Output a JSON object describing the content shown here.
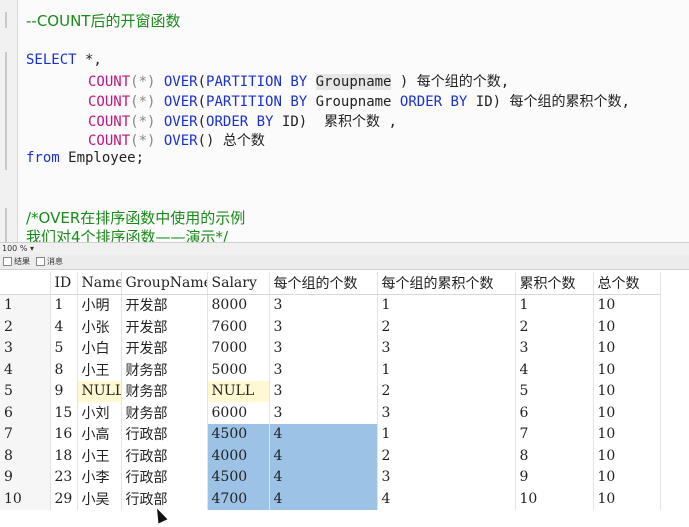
{
  "editor": {
    "comment_top": "--COUNT后的开窗函数",
    "select_kw": "SELECT",
    "select_rest": " *,",
    "lines": [
      {
        "fn": "COUNT",
        "args": "(*) ",
        "over": "OVER",
        "body_a": "(",
        "k1": "PARTITION BY",
        "body_b": " ",
        "hl": "Groupname",
        "body_c": " ) ",
        "k2": "",
        "body_d": "",
        "comment": "每个组的个数",
        "tail": ","
      },
      {
        "fn": "COUNT",
        "args": "(*) ",
        "over": "OVER",
        "body_a": "(",
        "k1": "PARTITION BY",
        "body_b": " Groupname ",
        "hl": "",
        "body_c": "",
        "k2": "ORDER BY",
        "body_d": " ID) ",
        "comment": "每个组的累积个数",
        "tail": ","
      },
      {
        "fn": "COUNT",
        "args": "(*) ",
        "over": "OVER",
        "body_a": "(",
        "k1": "ORDER BY",
        "body_b": " ID)  ",
        "hl": "",
        "body_c": "",
        "k2": "",
        "body_d": "",
        "comment": "累积个数",
        "tail": " ,"
      },
      {
        "fn": "COUNT",
        "args": "(*) ",
        "over": "OVER",
        "body_a": "() ",
        "k1": "",
        "body_b": "",
        "hl": "",
        "body_c": "",
        "k2": "",
        "body_d": "",
        "comment": "总个数",
        "tail": ""
      }
    ],
    "from_kw": "from",
    "from_rest": " Employee;",
    "comment_b1": "/*OVER在排序函数中使用的示例",
    "comment_b2": "我们对4个排序函数——演示*/"
  },
  "zoom": "100 %",
  "result_tabs": {
    "results": "结果",
    "messages": "消息"
  },
  "results": {
    "columns": [
      "",
      "ID",
      "Name",
      "GroupName",
      "Salary",
      "每个组的个数",
      "每个组的累积个数",
      "累积个数",
      "总个数"
    ],
    "rows": [
      [
        "1",
        "1",
        "小明",
        "开发部",
        "8000",
        "3",
        "1",
        "1",
        "10"
      ],
      [
        "2",
        "4",
        "小张",
        "开发部",
        "7600",
        "3",
        "2",
        "2",
        "10"
      ],
      [
        "3",
        "5",
        "小白",
        "开发部",
        "7000",
        "3",
        "3",
        "3",
        "10"
      ],
      [
        "4",
        "8",
        "小王",
        "财务部",
        "5000",
        "3",
        "1",
        "4",
        "10"
      ],
      [
        "5",
        "9",
        "NULL",
        "财务部",
        "NULL",
        "3",
        "2",
        "5",
        "10"
      ],
      [
        "6",
        "15",
        "小刘",
        "财务部",
        "6000",
        "3",
        "3",
        "6",
        "10"
      ],
      [
        "7",
        "16",
        "小高",
        "行政部",
        "4500",
        "4",
        "1",
        "7",
        "10"
      ],
      [
        "8",
        "18",
        "小王",
        "行政部",
        "4000",
        "4",
        "2",
        "8",
        "10"
      ],
      [
        "9",
        "23",
        "小李",
        "行政部",
        "4500",
        "4",
        "3",
        "9",
        "10"
      ],
      [
        "10",
        "29",
        "小吴",
        "行政部",
        "4700",
        "4",
        "4",
        "10",
        "10"
      ]
    ]
  },
  "colors": {
    "keyword": "#1a2fd4",
    "function": "#c0157a",
    "comment": "#1a8a1a",
    "selection": "#9cc3e6",
    "null_cell": "#fff8d0"
  }
}
